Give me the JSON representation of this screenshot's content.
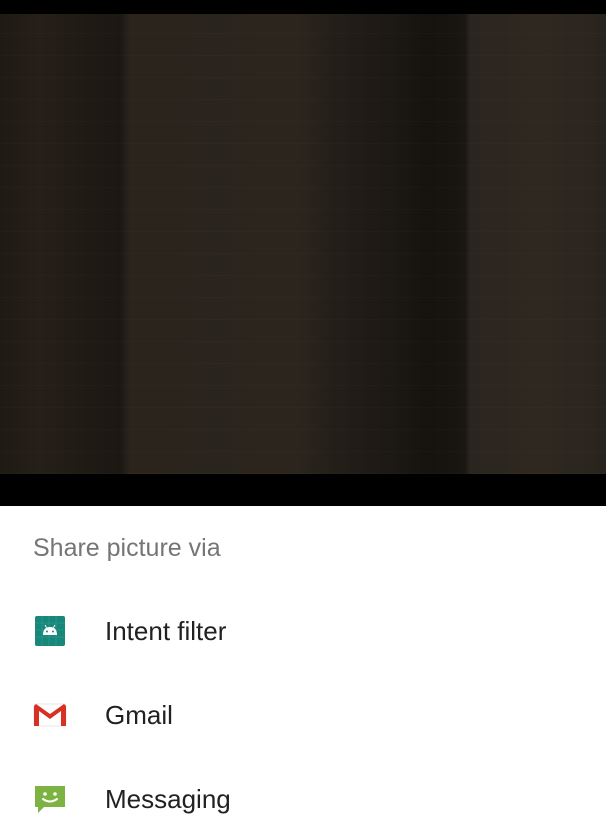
{
  "share_sheet": {
    "title": "Share picture via",
    "apps": [
      {
        "label": "Intent filter",
        "icon": "android-icon",
        "color": "#18877a"
      },
      {
        "label": "Gmail",
        "icon": "gmail-icon",
        "color": "#d93025"
      },
      {
        "label": "Messaging",
        "icon": "messaging-icon",
        "color": "#7cb342"
      }
    ]
  }
}
